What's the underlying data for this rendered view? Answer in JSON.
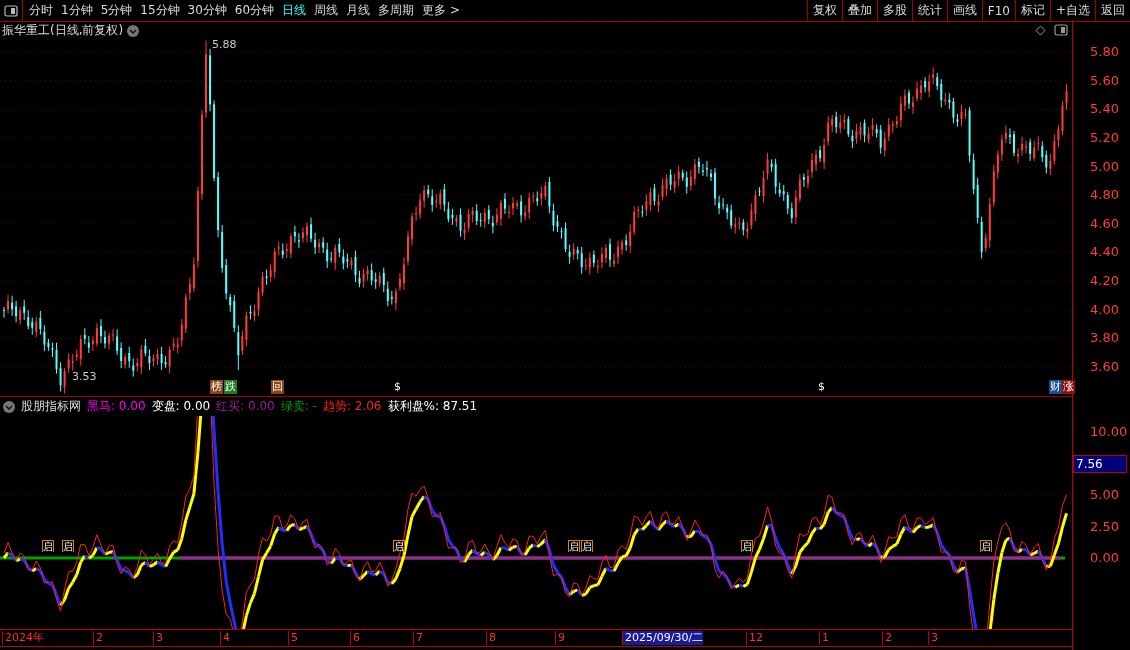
{
  "toolbar": {
    "periods": [
      {
        "label": "分时",
        "selected": false
      },
      {
        "label": "1分钟",
        "selected": false
      },
      {
        "label": "5分钟",
        "selected": false
      },
      {
        "label": "15分钟",
        "selected": false
      },
      {
        "label": "30分钟",
        "selected": false
      },
      {
        "label": "60分钟",
        "selected": false
      },
      {
        "label": "日线",
        "selected": true
      },
      {
        "label": "周线",
        "selected": false
      },
      {
        "label": "月线",
        "selected": false
      },
      {
        "label": "多周期",
        "selected": false
      },
      {
        "label": "更多 >",
        "selected": false
      }
    ],
    "actions": [
      "复权",
      "叠加",
      "多股",
      "统计",
      "画线",
      "F10",
      "标记",
      "+自选",
      "返回"
    ]
  },
  "price_panel": {
    "title": "振华重工(日线,前复权)",
    "axis_ticks": [
      "5.80",
      "5.60",
      "5.40",
      "5.20",
      "5.00",
      "4.80",
      "4.60",
      "4.40",
      "4.20",
      "4.00",
      "3.80",
      "3.60"
    ],
    "high_label": "5.88",
    "low_label": "3.53",
    "markers": [
      {
        "label": "榜",
        "color": "#8b4513"
      },
      {
        "label": "跌",
        "color": "#1e7b1e"
      },
      {
        "label": "回",
        "color": "#8b4513"
      },
      {
        "label": "$",
        "color": "#000000"
      },
      {
        "label": "$",
        "color": "#000000"
      },
      {
        "label": "财",
        "color": "#1c4e8c"
      },
      {
        "label": "涨",
        "color": "#8b1010"
      }
    ]
  },
  "indicator_panel": {
    "name": "股朋指标网",
    "readouts": [
      {
        "label": "黑马: 0.00",
        "color": "#ff00ff"
      },
      {
        "label": "变盘: 0.00",
        "color": "#ffffff"
      },
      {
        "label": "红买: 0.00",
        "color": "#9a1fa0"
      },
      {
        "label": "绿卖: -",
        "color": "#00a000"
      },
      {
        "label": "趋势: 2.06",
        "color": "#ff2020"
      },
      {
        "label": "获利盘%: 87.51",
        "color": "#ffffff"
      }
    ],
    "axis_ticks": [
      "10.00",
      "5.00",
      "2.50",
      "0.00"
    ],
    "current_value": "7.56",
    "signals": [
      {
        "label": "启"
      },
      {
        "label": "启"
      },
      {
        "label": "启"
      },
      {
        "label": "启"
      },
      {
        "label": "启"
      },
      {
        "label": "启"
      },
      {
        "label": "启"
      }
    ]
  },
  "date_axis": [
    {
      "label": "2024年",
      "selected": false
    },
    {
      "label": "2",
      "selected": false
    },
    {
      "label": "3",
      "selected": false
    },
    {
      "label": "4",
      "selected": false
    },
    {
      "label": "5",
      "selected": false
    },
    {
      "label": "6",
      "selected": false
    },
    {
      "label": "7",
      "selected": false
    },
    {
      "label": "8",
      "selected": false
    },
    {
      "label": "9",
      "selected": false
    },
    {
      "label": "2025/09/30/二",
      "selected": true
    },
    {
      "label": "12",
      "selected": false
    },
    {
      "label": "1",
      "selected": false
    },
    {
      "label": "2",
      "selected": false
    },
    {
      "label": "3",
      "selected": false
    }
  ]
}
